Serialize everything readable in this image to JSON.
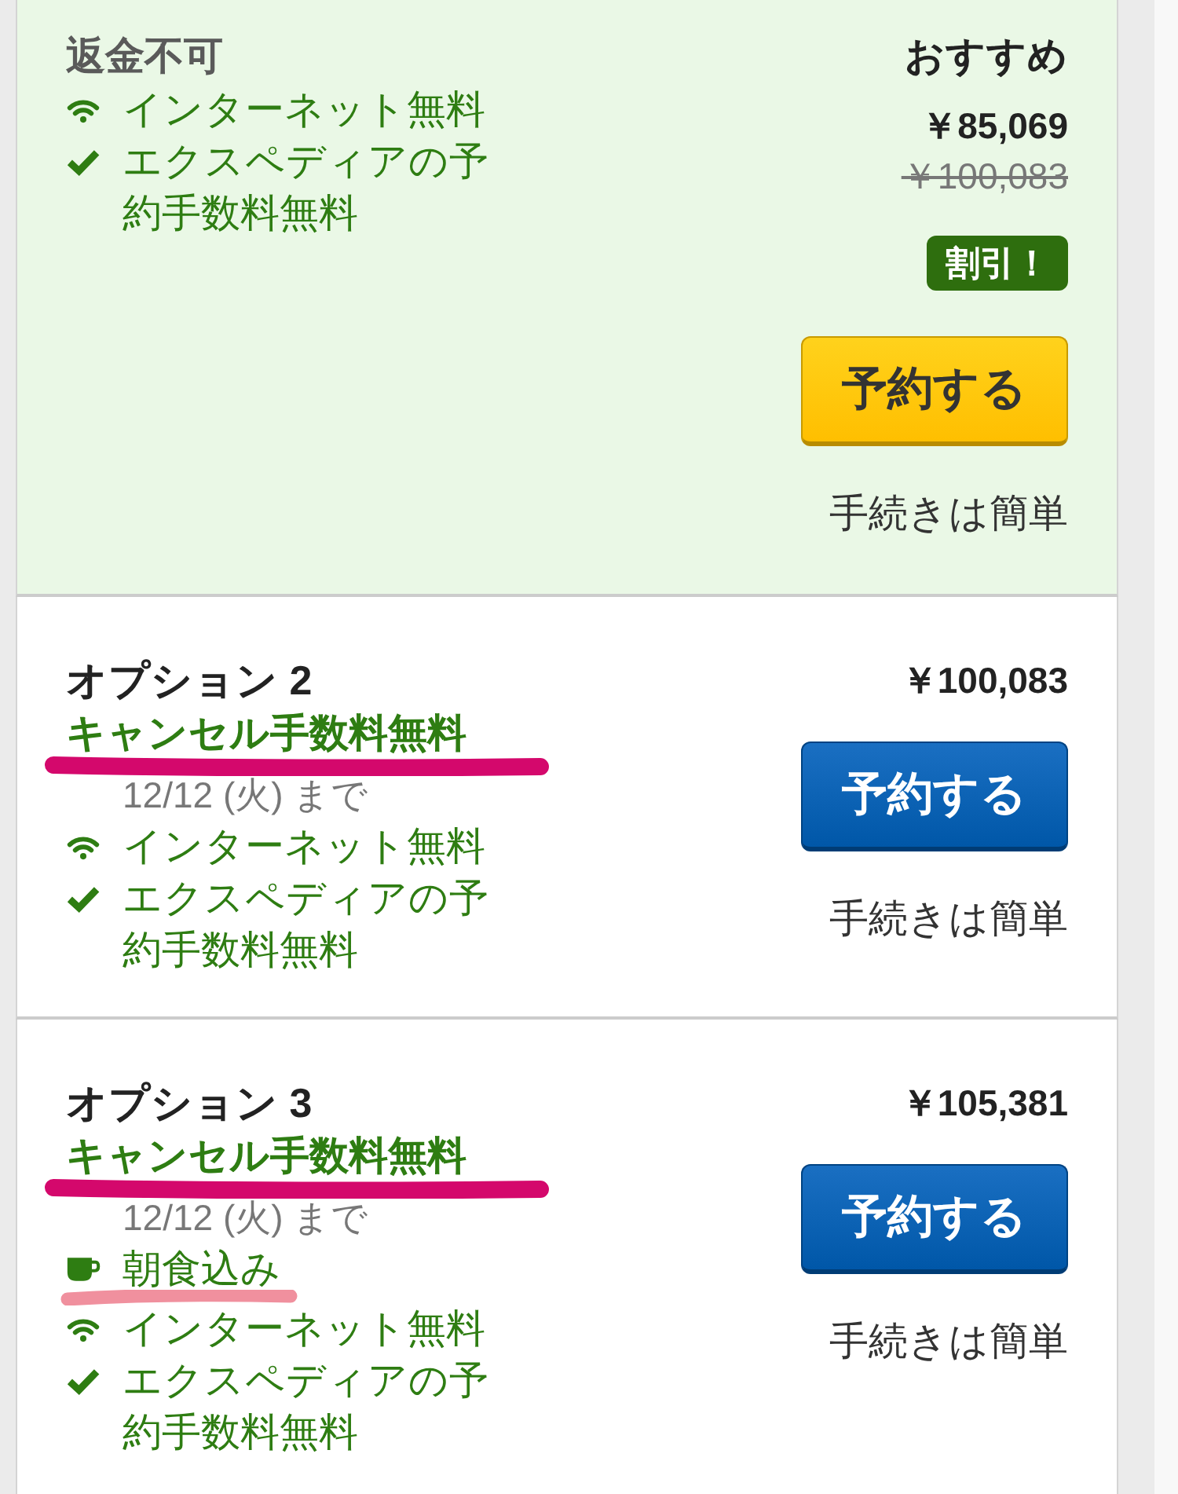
{
  "offers": [
    {
      "featured": true,
      "policy": {
        "text": "返金不可",
        "refundable": false,
        "marked": false
      },
      "features": [
        {
          "kind": "wifi",
          "text": "インターネット無料",
          "marked": false
        },
        {
          "kind": "check",
          "text": "エクスペディアの予約手数料無料",
          "marked": false
        }
      ],
      "recommended_label": "おすすめ",
      "price": "￥85,069",
      "original_price": "￥100,083",
      "badge": "割引！",
      "button": "予約する",
      "note": "手続きは簡単"
    },
    {
      "featured": false,
      "title": "オプション 2",
      "policy": {
        "text": "キャンセル手数料無料",
        "refundable": true,
        "marked": true
      },
      "deadline": "12/12 (火) まで",
      "features": [
        {
          "kind": "wifi",
          "text": "インターネット無料",
          "marked": false
        },
        {
          "kind": "check",
          "text": "エクスペディアの予約手数料無料",
          "marked": false
        }
      ],
      "price": "￥100,083",
      "button": "予約する",
      "note": "手続きは簡単"
    },
    {
      "featured": false,
      "title": "オプション 3",
      "policy": {
        "text": "キャンセル手数料無料",
        "refundable": true,
        "marked": true
      },
      "deadline": "12/12 (火) まで",
      "features": [
        {
          "kind": "breakfast",
          "text": "朝食込み",
          "marked": true
        },
        {
          "kind": "wifi",
          "text": "インターネット無料",
          "marked": false
        },
        {
          "kind": "check",
          "text": "エクスペディアの予約手数料無料",
          "marked": false
        }
      ],
      "price": "￥105,381",
      "button": "予約する",
      "note": "手続きは簡単"
    }
  ]
}
